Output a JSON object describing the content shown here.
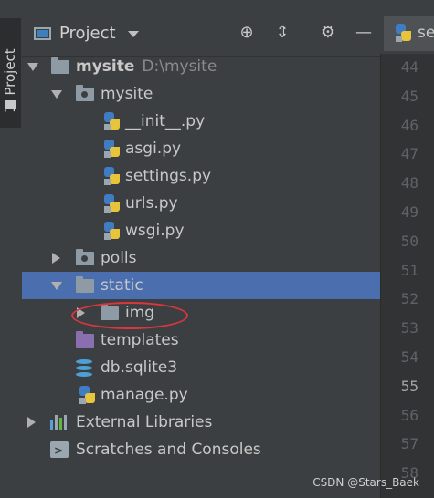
{
  "side_tab": {
    "label": "1: Project"
  },
  "toolbar": {
    "title": "Project",
    "locate_icon": "⊕",
    "collapse_icon": "⇕",
    "gear_icon": "⚙",
    "hide_icon": "—"
  },
  "tree": {
    "root": {
      "name": "mysite",
      "path": "D:\\mysite"
    },
    "pkg": {
      "name": "mysite"
    },
    "files": [
      "__init__.py",
      "asgi.py",
      "settings.py",
      "urls.py",
      "wsgi.py"
    ],
    "polls": "polls",
    "static": "static",
    "img": "img",
    "templates": "templates",
    "db": "db.sqlite3",
    "manage": "manage.py",
    "external": "External Libraries",
    "scratches": "Scratches and Consoles"
  },
  "editor": {
    "tab_label": "se",
    "line_numbers": [
      "44",
      "45",
      "46",
      "47",
      "48",
      "49",
      "50",
      "51",
      "52",
      "53",
      "54",
      "55",
      "56",
      "57",
      "58"
    ],
    "current_line": "55"
  },
  "watermark": "CSDN @Stars_Baek"
}
